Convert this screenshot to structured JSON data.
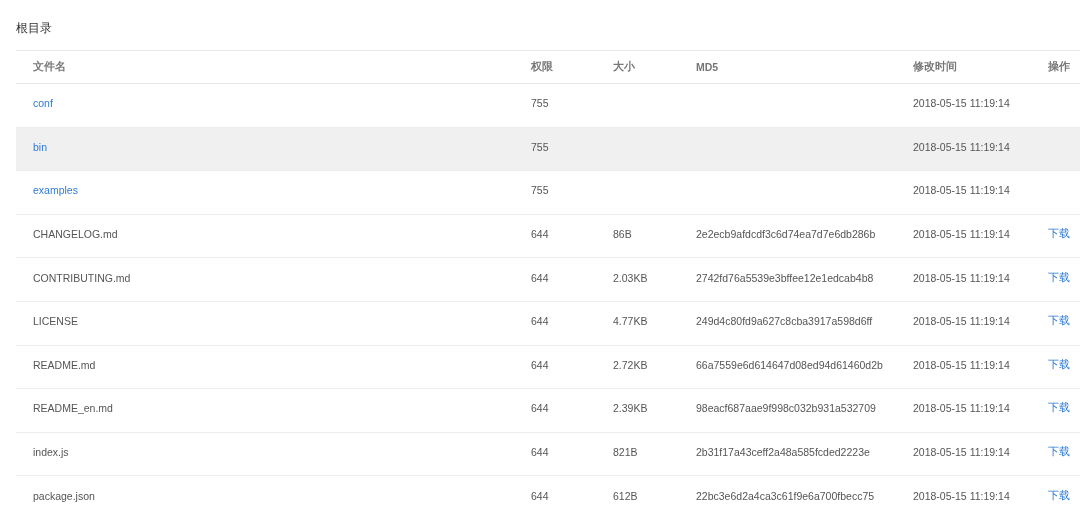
{
  "title": "根目录",
  "table": {
    "columns": [
      "文件名",
      "权限",
      "大小",
      "MD5",
      "修改时间",
      "操作"
    ],
    "rows": [
      {
        "kind": "dir",
        "name": "conf",
        "permission": "755",
        "modified": "2018-05-15 11:19:14",
        "highlighted": false
      },
      {
        "kind": "dir",
        "name": "bin",
        "permission": "755",
        "modified": "2018-05-15 11:19:14",
        "highlighted": true
      },
      {
        "kind": "dir",
        "name": "examples",
        "permission": "755",
        "modified": "2018-05-15 11:19:14",
        "highlighted": false
      },
      {
        "kind": "file",
        "name": "CHANGELOG.md",
        "permission": "644",
        "size": "86B",
        "md5": "2e2ecb9afdcdf3c6d74ea7d7e6db286b",
        "modified": "2018-05-15 11:19:14",
        "action": "下载",
        "highlighted": false
      },
      {
        "kind": "file",
        "name": "CONTRIBUTING.md",
        "permission": "644",
        "size": "2.03KB",
        "md5": "2742fd76a5539e3bffee12e1edcab4b8",
        "modified": "2018-05-15 11:19:14",
        "action": "下载",
        "highlighted": false
      },
      {
        "kind": "file",
        "name": "LICENSE",
        "permission": "644",
        "size": "4.77KB",
        "md5": "249d4c80fd9a627c8cba3917a598d6ff",
        "modified": "2018-05-15 11:19:14",
        "action": "下载",
        "highlighted": false
      },
      {
        "kind": "file",
        "name": "README.md",
        "permission": "644",
        "size": "2.72KB",
        "md5": "66a7559e6d614647d08ed94d61460d2b",
        "modified": "2018-05-15 11:19:14",
        "action": "下载",
        "highlighted": false
      },
      {
        "kind": "file",
        "name": "README_en.md",
        "permission": "644",
        "size": "2.39KB",
        "md5": "98eacf687aae9f998c032b931a532709",
        "modified": "2018-05-15 11:19:14",
        "action": "下载",
        "highlighted": false
      },
      {
        "kind": "file",
        "name": "index.js",
        "permission": "644",
        "size": "821B",
        "md5": "2b31f17a43ceff2a48a585fcded2223e",
        "modified": "2018-05-15 11:19:14",
        "action": "下载",
        "highlighted": false
      },
      {
        "kind": "file",
        "name": "package.json",
        "permission": "644",
        "size": "612B",
        "md5": "22bc3e6d2a4ca3c61f9e6a700fbecc75",
        "modified": "2018-05-15 11:19:14",
        "action": "下载",
        "highlighted": false
      }
    ]
  }
}
